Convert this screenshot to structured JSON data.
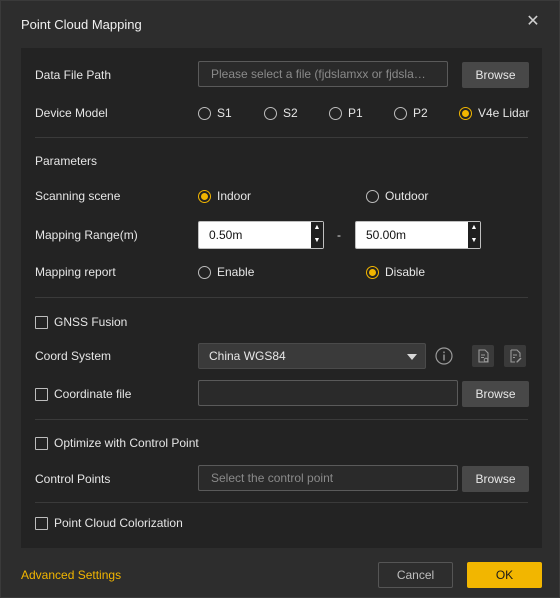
{
  "dialog": {
    "title": "Point Cloud Mapping",
    "close_icon": "close-icon"
  },
  "data_file": {
    "label": "Data File Path",
    "placeholder": "Please select a file (fjdslamxx or fjdslam…",
    "browse": "Browse"
  },
  "device_model": {
    "label": "Device Model",
    "options": [
      "S1",
      "S2",
      "P1",
      "P2",
      "V4e Lidar"
    ],
    "selected": "V4e Lidar"
  },
  "parameters": {
    "heading": "Parameters",
    "scanning_scene": {
      "label": "Scanning scene",
      "options": [
        "Indoor",
        "Outdoor"
      ],
      "selected": "Indoor"
    },
    "mapping_range": {
      "label": "Mapping Range(m)",
      "min": "0.50m",
      "separator": "-",
      "max": "50.00m"
    },
    "mapping_report": {
      "label": "Mapping report",
      "options": [
        "Enable",
        "Disable"
      ],
      "selected": "Disable"
    }
  },
  "gnss": {
    "fusion_label": "GNSS Fusion",
    "fusion_checked": false,
    "coord_system_label": "Coord System",
    "coord_system_value": "China WGS84",
    "coordinate_file_label": "Coordinate file",
    "coordinate_file_checked": false,
    "coordinate_file_value": "",
    "browse": "Browse",
    "icons": [
      "info-icon",
      "import-file-icon",
      "edit-file-icon"
    ]
  },
  "control": {
    "optimize_label": "Optimize with Control Point",
    "optimize_checked": false,
    "points_label": "Control Points",
    "points_placeholder": "Select the control point",
    "browse": "Browse"
  },
  "colorization": {
    "label": "Point Cloud Colorization",
    "checked": false
  },
  "footer": {
    "advanced": "Advanced Settings",
    "cancel": "Cancel",
    "ok": "OK"
  },
  "colors": {
    "accent": "#f2b600",
    "background": "#2d2d2d",
    "panel": "#232323"
  }
}
